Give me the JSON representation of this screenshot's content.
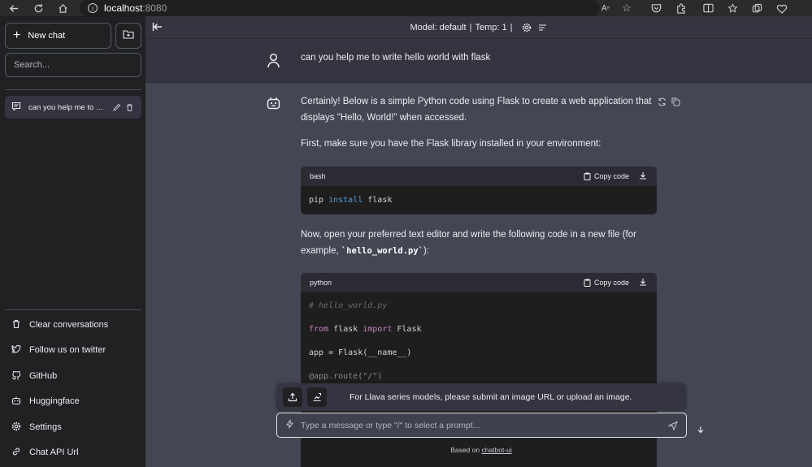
{
  "browser": {
    "url_host": "localhost",
    "url_port": ":8080",
    "icons": [
      "back-icon",
      "reload-icon",
      "home-icon",
      "info-icon",
      "read-aloud-icon",
      "favorite-star-icon",
      "pocket-icon",
      "extensions-icon",
      "split-screen-icon",
      "favorites-icon",
      "collections-icon",
      "performance-icon"
    ]
  },
  "sidebar": {
    "new_chat_label": "New chat",
    "search_placeholder": "Search...",
    "conversations": [
      {
        "title": "can you help me to write hello world with flask"
      }
    ],
    "footer": [
      {
        "label": "Clear conversations",
        "icon": "trash-icon"
      },
      {
        "label": "Follow us on twitter",
        "icon": "twitter-icon"
      },
      {
        "label": "GitHub",
        "icon": "github-icon"
      },
      {
        "label": "Huggingface",
        "icon": "robot-icon"
      },
      {
        "label": "Settings",
        "icon": "gear-icon"
      },
      {
        "label": "Chat API Url",
        "icon": "link-icon"
      }
    ]
  },
  "topbar": {
    "model_label": "Model: default",
    "separator": "|",
    "temp_label": "Temp: 1"
  },
  "conversation": {
    "user_message": "can you help me to write hello world with flask",
    "bot": {
      "para1": "Certainly! Below is a simple Python code using Flask to create a web application that displays \"Hello, World!\" when accessed.",
      "para2": "First, make sure you have the Flask library installed in your environment:",
      "para3_pre": "Now, open your preferred text editor and write the following code in a new file (for example, ",
      "para3_code": "`hello_world.py`",
      "para3_post": "):",
      "code1": {
        "lang": "bash",
        "copy_label": "Copy code",
        "tokens": [
          "pip ",
          "install",
          " flask"
        ]
      },
      "code2": {
        "lang": "python",
        "copy_label": "Copy code",
        "line1": "# hello_world.py",
        "line2_kw1": "from",
        "line2_mid": " flask ",
        "line2_kw2": "import",
        "line2_end": " Flask",
        "line3": "app = Flask(__name__)",
        "line4": "@app.route(\"/\")"
      }
    }
  },
  "composer": {
    "image_note": "For Llava series models, please submit an image URL or upload an image.",
    "placeholder": "Type a message or type \"/\" to select a prompt...",
    "footer_prefix": "Based on ",
    "footer_link": "chatbot-ui"
  },
  "colors": {
    "sidebar_bg": "#202123",
    "main_bg": "#343541",
    "bot_bg": "#444654",
    "code_bg": "#1e1e1e",
    "keyword_blue": "#569cd6",
    "keyword_purple": "#c586c0"
  }
}
